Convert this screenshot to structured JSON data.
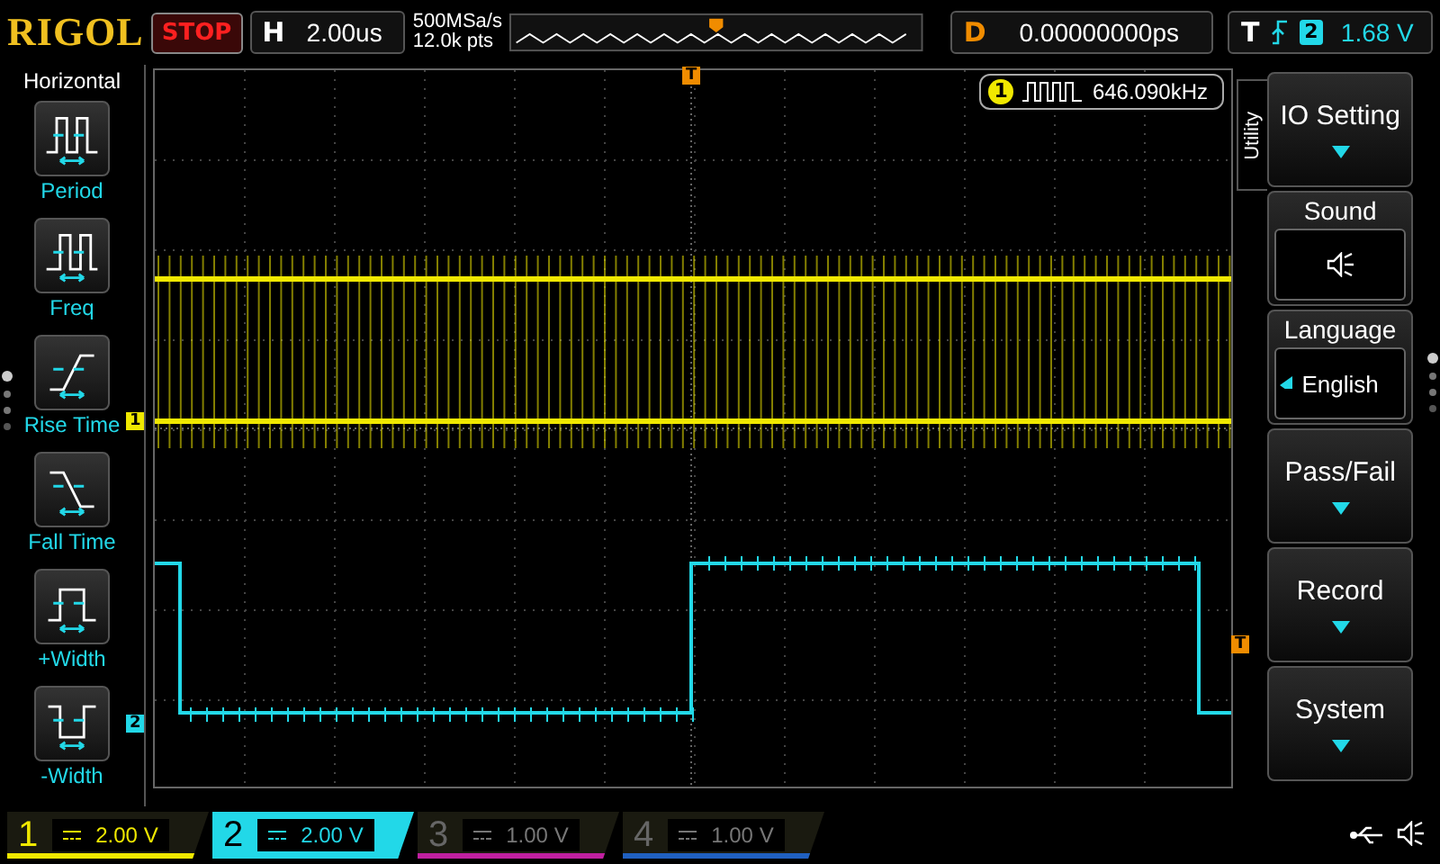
{
  "top_bar": {
    "brand": "RIGOL",
    "run_state": "STOP",
    "horizontal": {
      "label": "H",
      "value": "2.00us"
    },
    "sample_rate": "500MSa/s",
    "memory_depth": "12.0k pts",
    "delay": {
      "label": "D",
      "value": "0.00000000ps"
    },
    "trigger": {
      "label": "T",
      "source": "2",
      "level": "1.68 V"
    }
  },
  "left_menu": {
    "title": "Horizontal",
    "items": [
      {
        "label": "Period",
        "kind": "period"
      },
      {
        "label": "Freq",
        "kind": "freq"
      },
      {
        "label": "Rise Time",
        "kind": "rise"
      },
      {
        "label": "Fall Time",
        "kind": "fall"
      },
      {
        "label": "+Width",
        "kind": "pwidth"
      },
      {
        "label": "-Width",
        "kind": "nwidth"
      }
    ]
  },
  "screen": {
    "trigger_marker": "T",
    "measurement": {
      "channel": "1",
      "value": "646.090kHz"
    },
    "channel_markers": [
      {
        "label": "1",
        "color": "#f0e800"
      },
      {
        "label": "2",
        "color": "#22d8e8"
      }
    ],
    "trigger_level_marker": "T"
  },
  "right_menu": {
    "tab": "Utility",
    "items": [
      {
        "kind": "submenu",
        "label": "IO Setting"
      },
      {
        "kind": "sound",
        "label": "Sound",
        "on": true
      },
      {
        "kind": "option",
        "label": "Language",
        "value": "English"
      },
      {
        "kind": "submenu",
        "label": "Pass/Fail"
      },
      {
        "kind": "submenu",
        "label": "Record"
      },
      {
        "kind": "submenu",
        "label": "System"
      }
    ]
  },
  "channels": [
    {
      "number": "1",
      "value": "2.00 V",
      "on": true,
      "selected": false,
      "color": "#f0e800"
    },
    {
      "number": "2",
      "value": "2.00 V",
      "on": true,
      "selected": true,
      "color": "#22d8e8"
    },
    {
      "number": "3",
      "value": "1.00 V",
      "on": false,
      "selected": false,
      "color": "#c020a0"
    },
    {
      "number": "4",
      "value": "1.00 V",
      "on": false,
      "selected": false,
      "color": "#2060c0"
    }
  ]
}
